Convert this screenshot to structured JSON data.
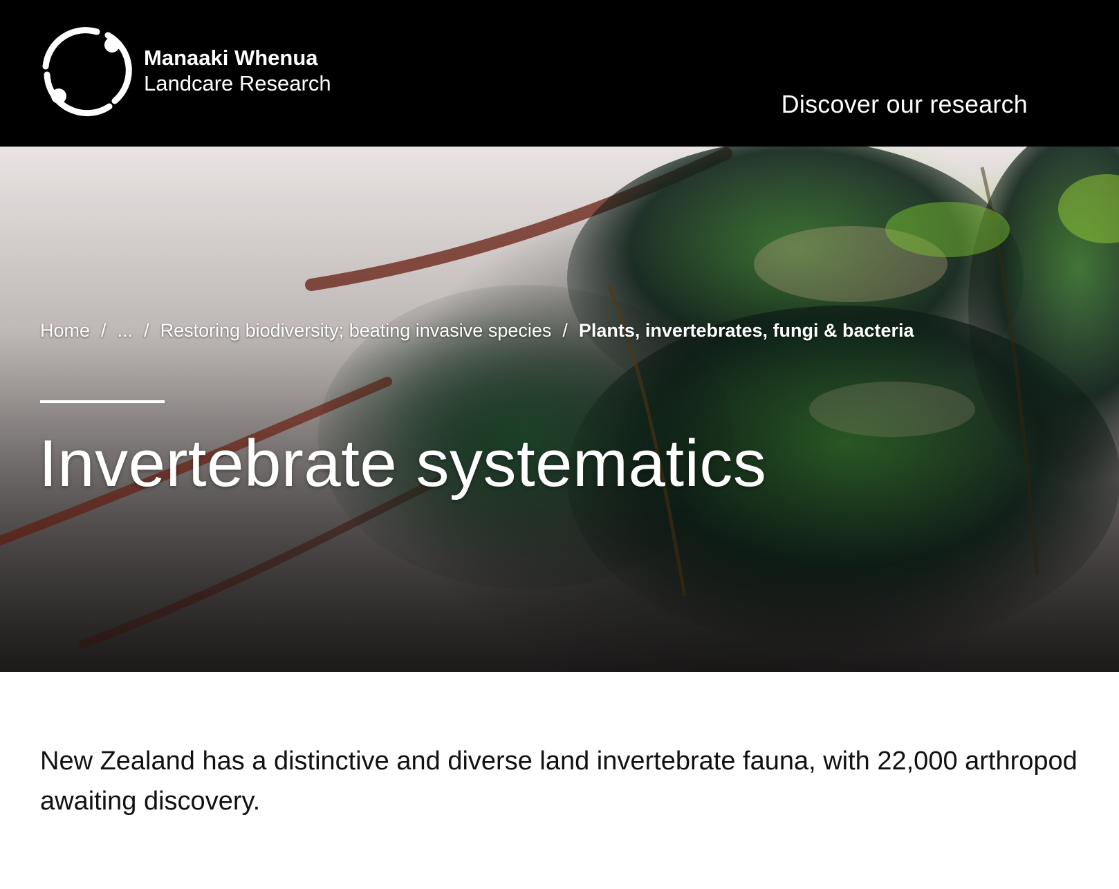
{
  "header": {
    "logo_line1": "Manaaki Whenua",
    "logo_line2": "Landcare Research",
    "nav_discover": "Discover our research"
  },
  "breadcrumb": {
    "items": [
      {
        "label": "Home"
      },
      {
        "label": "..."
      },
      {
        "label": "Restoring biodiversity; beating invasive species"
      },
      {
        "label": "Plants, invertebrates, fungi & bacteria"
      }
    ],
    "separator": "/"
  },
  "hero": {
    "title": "Invertebrate systematics"
  },
  "intro": {
    "text": "New Zealand has a distinctive and diverse land invertebrate fauna, with 22,000 arthropod awaiting discovery."
  },
  "colors": {
    "header_bg": "#000000",
    "text_on_dark": "#ffffff",
    "body_text": "#111111"
  }
}
